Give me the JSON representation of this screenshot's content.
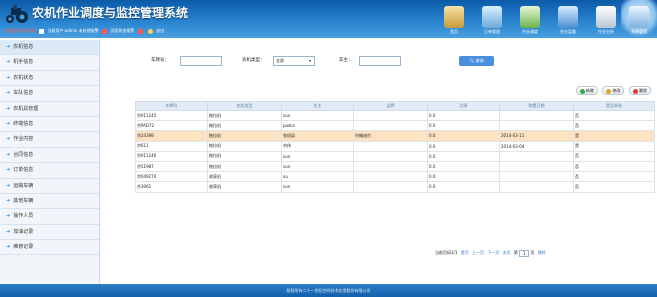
{
  "header": {
    "title": "农机作业调度与监控管理系统",
    "welcome": "欢迎登录农机系统",
    "current_user": "当前用户:admin 未处理报警",
    "view_alarms": "页面状态报警",
    "logout": "退出",
    "colors": {
      "bar": "#1a6fc0",
      "accent": "#ff5a4a"
    }
  },
  "nav": {
    "items": [
      {
        "label": "首页",
        "icon": "home-icon"
      },
      {
        "label": "订单管理",
        "icon": "order-icon"
      },
      {
        "label": "作业调度",
        "icon": "dispatch-icon"
      },
      {
        "label": "作业监督",
        "icon": "monitor-icon"
      },
      {
        "label": "作业分析",
        "icon": "analysis-icon"
      },
      {
        "label": "系统管理",
        "icon": "system-icon"
      }
    ]
  },
  "sidebar": {
    "items": [
      {
        "label": "农机信息"
      },
      {
        "label": "机手信息"
      },
      {
        "label": "农机状态"
      },
      {
        "label": "车队信息"
      },
      {
        "label": "农机具管理"
      },
      {
        "label": "终端信息"
      },
      {
        "label": "作业内容"
      },
      {
        "label": "合同信息"
      },
      {
        "label": "订单信息"
      },
      {
        "label": "运输车辆"
      },
      {
        "label": "其他车辆"
      },
      {
        "label": "操作人员"
      },
      {
        "label": "加油记录"
      },
      {
        "label": "维修记录"
      }
    ]
  },
  "search": {
    "plate_label": "车牌号：",
    "plate_value": "",
    "type_label": "农机类型：",
    "type_value": "全部",
    "owner_label": "车主：",
    "owner_value": "",
    "button": "查询"
  },
  "toolbar": {
    "add": "新增",
    "edit": "修改",
    "delete": "删除"
  },
  "table": {
    "columns": [
      "车牌号",
      "农机类型",
      "车主",
      "品牌",
      "功率",
      "购置日期",
      "是否补贴"
    ],
    "rows": [
      [
        "京011145",
        "拖拉机",
        "sun",
        "",
        "0.0",
        "",
        "否"
      ],
      [
        "京PAD72",
        "拖拉机",
        "padcs",
        "",
        "0.0",
        "",
        "否"
      ],
      [
        "京24398",
        "拖拉机",
        "农机局",
        "约翰迪尔",
        "0.0",
        "2014-03-11",
        "是"
      ],
      [
        "京611",
        "拖拉机",
        "刘伟",
        "",
        "0.0",
        "2014-03-04",
        "是"
      ],
      [
        "京011146",
        "拖拉机",
        "sun",
        "",
        "0.0",
        "",
        "否"
      ],
      [
        "京51987",
        "拖拉机",
        "sun",
        "",
        "0.0",
        "",
        "否"
      ],
      [
        "京049270",
        "收获机",
        "xu",
        "",
        "0.0",
        "",
        "否"
      ],
      [
        "京3061",
        "收获机",
        "sun",
        "",
        "0.0",
        "",
        "否"
      ]
    ],
    "highlight_row": 2
  },
  "pager": {
    "info": "当前页码1/1",
    "first": "首页",
    "prev": "上一页",
    "next": "下一页",
    "last": "末页",
    "goto_prefix": "第",
    "page_value": "1",
    "goto_suffix": "页",
    "go": "跳转"
  },
  "footer": {
    "copyright": "版权所有二十一世纪空间技术应用股份有限公司"
  }
}
